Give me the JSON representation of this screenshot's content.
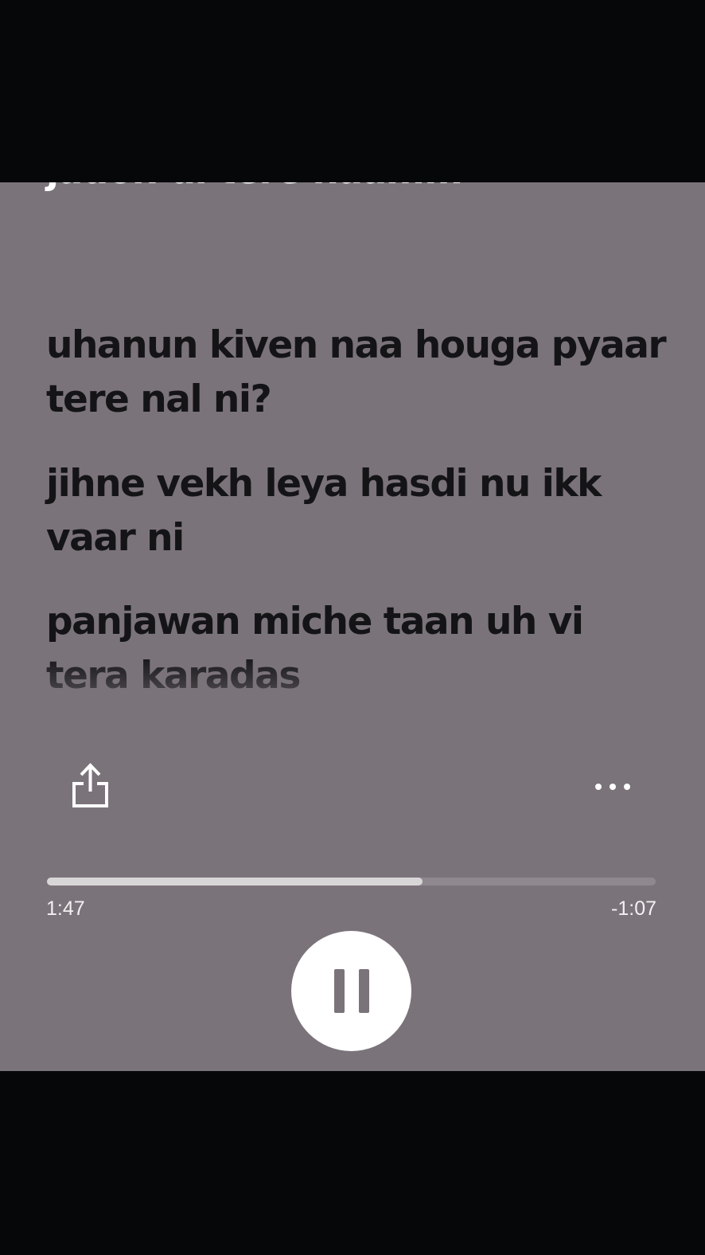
{
  "lyrics": {
    "previous_line": "jadon di tere naam...",
    "lines": [
      "uhanun kiven naa houga pyaar tere nal ni?",
      "jihne vekh leya hasdi nu ikk vaar ni",
      "panjawan miche taan uh vi tera karadas"
    ]
  },
  "controls": {
    "share_icon": "share-icon",
    "more_icon": "more-icon",
    "play_state_icon": "pause-icon"
  },
  "playback": {
    "elapsed": "1:47",
    "remaining": "-1:07",
    "progress_fraction": 0.617
  },
  "colors": {
    "background": "#7b737a",
    "lyric_text": "#141416",
    "progress_fill": "#d9d6d8",
    "progress_track": "#8f888e"
  }
}
